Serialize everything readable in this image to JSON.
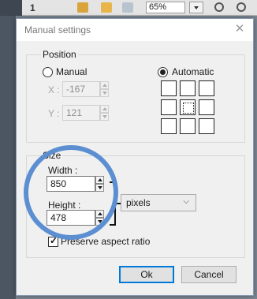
{
  "background_toolbar": {
    "number": "1",
    "zoom": "65%"
  },
  "dialog": {
    "title": "Manual settings",
    "close_glyph": "✕",
    "position": {
      "legend": "Position",
      "manual_label": "Manual",
      "automatic_label": "Automatic",
      "selected_mode": "automatic",
      "x_label": "X :",
      "x_value": "-167",
      "y_label": "Y :",
      "y_value": "121",
      "anchor_selected_index": 4
    },
    "size": {
      "legend": "Size",
      "width_label": "Width :",
      "width_value": "850",
      "height_label": "Height :",
      "height_value": "478",
      "unit_value": "pixels",
      "preserve_label": "Preserve aspect ratio",
      "preserve_checked": true
    },
    "buttons": {
      "ok": "Ok",
      "cancel": "Cancel"
    }
  },
  "annotation": {
    "circle_color": "#5b8fd1",
    "bracket_color": "#111111"
  },
  "colors": {
    "accent": "#0078d7",
    "dim_text": "#a0a0a0"
  }
}
